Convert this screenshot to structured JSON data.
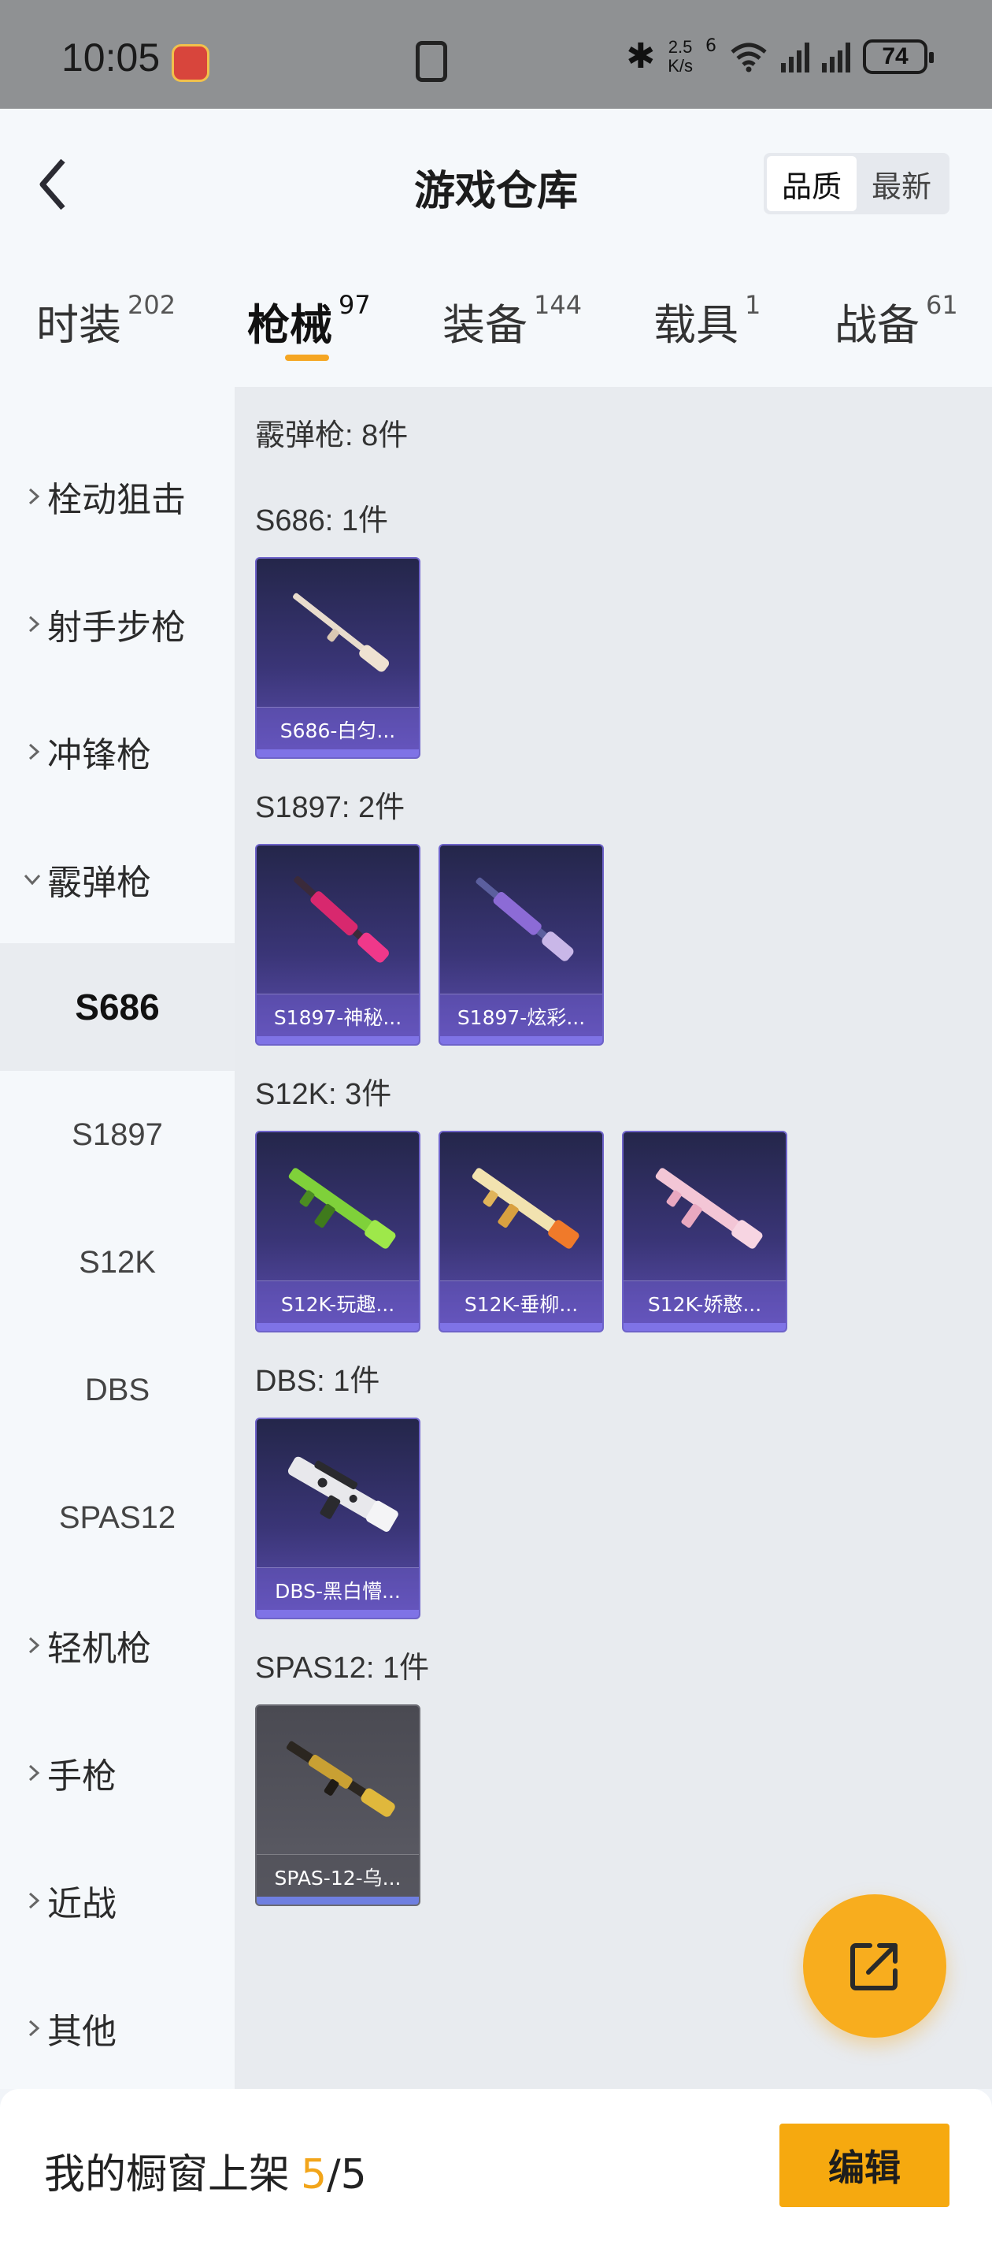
{
  "status_bar": {
    "time": "10:05",
    "speed_value": "2.5",
    "speed_unit": "K/s",
    "network_gen": "6",
    "battery": "74"
  },
  "header": {
    "title": "游戏仓库",
    "sort_options": [
      "品质",
      "最新"
    ],
    "sort_selected": "品质"
  },
  "tabs": [
    {
      "label": "时装",
      "count": "202"
    },
    {
      "label": "枪械",
      "count": "97",
      "active": true
    },
    {
      "label": "装备",
      "count": "144"
    },
    {
      "label": "载具",
      "count": "1"
    },
    {
      "label": "战备",
      "count": "61"
    }
  ],
  "sidebar": {
    "categories": [
      {
        "label": "栓动狙击",
        "expanded": false
      },
      {
        "label": "射手步枪",
        "expanded": false
      },
      {
        "label": "冲锋枪",
        "expanded": false
      },
      {
        "label": "霰弹枪",
        "expanded": true
      },
      {
        "label": "轻机枪",
        "expanded": false
      },
      {
        "label": "手枪",
        "expanded": false
      },
      {
        "label": "近战",
        "expanded": false
      },
      {
        "label": "其他",
        "expanded": false
      }
    ],
    "subitems": [
      "S686",
      "S1897",
      "S12K",
      "DBS",
      "SPAS12"
    ],
    "selected_sub": "S686"
  },
  "main": {
    "category_summary": "霰弹枪: 8件",
    "groups": [
      {
        "title": "S686: 1件",
        "items": [
          "S686-白匀..."
        ]
      },
      {
        "title": "S1897: 2件",
        "items": [
          "S1897-神秘...",
          "S1897-炫彩..."
        ]
      },
      {
        "title": "S12K: 3件",
        "items": [
          "S12K-玩趣...",
          "S12K-垂柳...",
          "S12K-娇憨..."
        ]
      },
      {
        "title": "DBS: 1件",
        "items": [
          "DBS-黑白懵..."
        ]
      },
      {
        "title": "SPAS12: 1件",
        "items": [
          "SPAS-12-乌..."
        ]
      }
    ]
  },
  "bottom_bar": {
    "label": "我的橱窗上架",
    "count": "5",
    "total": "/5",
    "edit_label": "编辑"
  },
  "colors": {
    "accent": "#f6a90f",
    "card_purple": "#5d4fb0",
    "card_gray": "#55555e"
  }
}
